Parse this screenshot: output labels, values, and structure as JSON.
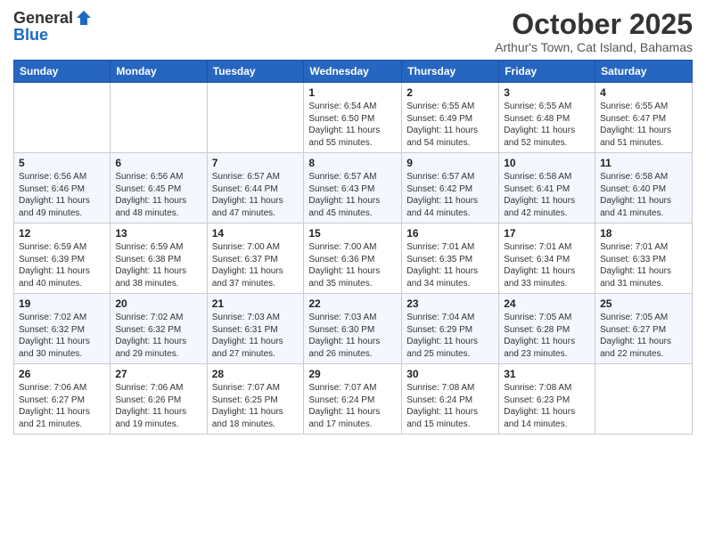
{
  "header": {
    "logo_general": "General",
    "logo_blue": "Blue",
    "month_title": "October 2025",
    "subtitle": "Arthur's Town, Cat Island, Bahamas"
  },
  "weekdays": [
    "Sunday",
    "Monday",
    "Tuesday",
    "Wednesday",
    "Thursday",
    "Friday",
    "Saturday"
  ],
  "weeks": [
    [
      {
        "day": "",
        "info": ""
      },
      {
        "day": "",
        "info": ""
      },
      {
        "day": "",
        "info": ""
      },
      {
        "day": "1",
        "info": "Sunrise: 6:54 AM\nSunset: 6:50 PM\nDaylight: 11 hours\nand 55 minutes."
      },
      {
        "day": "2",
        "info": "Sunrise: 6:55 AM\nSunset: 6:49 PM\nDaylight: 11 hours\nand 54 minutes."
      },
      {
        "day": "3",
        "info": "Sunrise: 6:55 AM\nSunset: 6:48 PM\nDaylight: 11 hours\nand 52 minutes."
      },
      {
        "day": "4",
        "info": "Sunrise: 6:55 AM\nSunset: 6:47 PM\nDaylight: 11 hours\nand 51 minutes."
      }
    ],
    [
      {
        "day": "5",
        "info": "Sunrise: 6:56 AM\nSunset: 6:46 PM\nDaylight: 11 hours\nand 49 minutes."
      },
      {
        "day": "6",
        "info": "Sunrise: 6:56 AM\nSunset: 6:45 PM\nDaylight: 11 hours\nand 48 minutes."
      },
      {
        "day": "7",
        "info": "Sunrise: 6:57 AM\nSunset: 6:44 PM\nDaylight: 11 hours\nand 47 minutes."
      },
      {
        "day": "8",
        "info": "Sunrise: 6:57 AM\nSunset: 6:43 PM\nDaylight: 11 hours\nand 45 minutes."
      },
      {
        "day": "9",
        "info": "Sunrise: 6:57 AM\nSunset: 6:42 PM\nDaylight: 11 hours\nand 44 minutes."
      },
      {
        "day": "10",
        "info": "Sunrise: 6:58 AM\nSunset: 6:41 PM\nDaylight: 11 hours\nand 42 minutes."
      },
      {
        "day": "11",
        "info": "Sunrise: 6:58 AM\nSunset: 6:40 PM\nDaylight: 11 hours\nand 41 minutes."
      }
    ],
    [
      {
        "day": "12",
        "info": "Sunrise: 6:59 AM\nSunset: 6:39 PM\nDaylight: 11 hours\nand 40 minutes."
      },
      {
        "day": "13",
        "info": "Sunrise: 6:59 AM\nSunset: 6:38 PM\nDaylight: 11 hours\nand 38 minutes."
      },
      {
        "day": "14",
        "info": "Sunrise: 7:00 AM\nSunset: 6:37 PM\nDaylight: 11 hours\nand 37 minutes."
      },
      {
        "day": "15",
        "info": "Sunrise: 7:00 AM\nSunset: 6:36 PM\nDaylight: 11 hours\nand 35 minutes."
      },
      {
        "day": "16",
        "info": "Sunrise: 7:01 AM\nSunset: 6:35 PM\nDaylight: 11 hours\nand 34 minutes."
      },
      {
        "day": "17",
        "info": "Sunrise: 7:01 AM\nSunset: 6:34 PM\nDaylight: 11 hours\nand 33 minutes."
      },
      {
        "day": "18",
        "info": "Sunrise: 7:01 AM\nSunset: 6:33 PM\nDaylight: 11 hours\nand 31 minutes."
      }
    ],
    [
      {
        "day": "19",
        "info": "Sunrise: 7:02 AM\nSunset: 6:32 PM\nDaylight: 11 hours\nand 30 minutes."
      },
      {
        "day": "20",
        "info": "Sunrise: 7:02 AM\nSunset: 6:32 PM\nDaylight: 11 hours\nand 29 minutes."
      },
      {
        "day": "21",
        "info": "Sunrise: 7:03 AM\nSunset: 6:31 PM\nDaylight: 11 hours\nand 27 minutes."
      },
      {
        "day": "22",
        "info": "Sunrise: 7:03 AM\nSunset: 6:30 PM\nDaylight: 11 hours\nand 26 minutes."
      },
      {
        "day": "23",
        "info": "Sunrise: 7:04 AM\nSunset: 6:29 PM\nDaylight: 11 hours\nand 25 minutes."
      },
      {
        "day": "24",
        "info": "Sunrise: 7:05 AM\nSunset: 6:28 PM\nDaylight: 11 hours\nand 23 minutes."
      },
      {
        "day": "25",
        "info": "Sunrise: 7:05 AM\nSunset: 6:27 PM\nDaylight: 11 hours\nand 22 minutes."
      }
    ],
    [
      {
        "day": "26",
        "info": "Sunrise: 7:06 AM\nSunset: 6:27 PM\nDaylight: 11 hours\nand 21 minutes."
      },
      {
        "day": "27",
        "info": "Sunrise: 7:06 AM\nSunset: 6:26 PM\nDaylight: 11 hours\nand 19 minutes."
      },
      {
        "day": "28",
        "info": "Sunrise: 7:07 AM\nSunset: 6:25 PM\nDaylight: 11 hours\nand 18 minutes."
      },
      {
        "day": "29",
        "info": "Sunrise: 7:07 AM\nSunset: 6:24 PM\nDaylight: 11 hours\nand 17 minutes."
      },
      {
        "day": "30",
        "info": "Sunrise: 7:08 AM\nSunset: 6:24 PM\nDaylight: 11 hours\nand 15 minutes."
      },
      {
        "day": "31",
        "info": "Sunrise: 7:08 AM\nSunset: 6:23 PM\nDaylight: 11 hours\nand 14 minutes."
      },
      {
        "day": "",
        "info": ""
      }
    ]
  ]
}
